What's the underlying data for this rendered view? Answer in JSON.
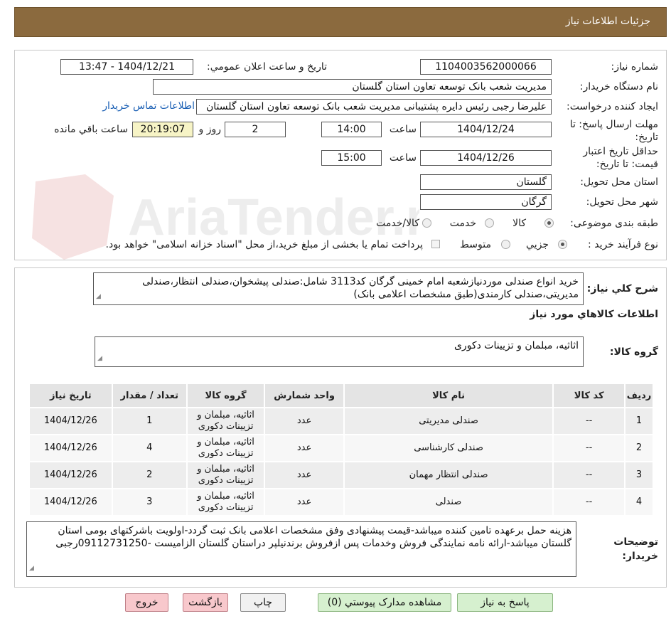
{
  "header": {
    "title": "جزئيات اطلاعات نياز"
  },
  "form": {
    "need_number_label": "شماره نياز:",
    "need_number": "1104003562000066",
    "announce_label": "تاريخ و ساعت اعلان عمومي:",
    "announce_value": "1404/12/21 - 13:47",
    "buyer_org_label": "نام دستگاه خريدار:",
    "buyer_org": "مدیریت شعب بانک توسعه تعاون استان گلستان",
    "creator_label": "ايجاد کننده درخواست:",
    "creator": "علیرضا رجبی رئیس دایره پشتیبانی مدیریت شعب بانک توسعه تعاون استان گلستان",
    "contact_link": "اطلاعات تماس خريدار",
    "deadline_label": "مهلت ارسال پاسخ: تا تاريخ:",
    "deadline_date": "1404/12/24",
    "time_label": "ساعت",
    "deadline_time": "14:00",
    "days": "2",
    "days_label": "روز و",
    "remaining": "20:19:07",
    "remaining_label": "ساعت باقي مانده",
    "validity_label": "حداقل تاريخ اعتبار قيمت: تا تاريخ:",
    "validity_date": "1404/12/26",
    "validity_time": "15:00",
    "province_label": "استان محل تحويل:",
    "province": "گلستان",
    "city_label": "شهر محل تحويل:",
    "city": "گرگان",
    "category_label": "طبقه بندی موضوعی:",
    "category_options": [
      "کالا",
      "خدمت",
      "کالا/خدمت"
    ],
    "purchase_type_label": "نوع فرآيند خريد :",
    "purchase_options": [
      "جزيي",
      "متوسط"
    ],
    "payment_note": "پرداخت تمام یا بخشی از مبلغ خرید،از محل \"اسناد خزانه اسلامی\" خواهد بود."
  },
  "summary": {
    "label": "شرح كلي نياز:",
    "text": "خرید  انواع صندلی  موردنیازشعبه امام خمینی گرگان کد3113 شامل:صندلی پیشخوان،صندلی انتظار،صندلی مدیریتی،صندلی کارمندی(طبق مشخصات اعلامی بانک)",
    "goods_heading": "اطلاعات كالاهاي مورد نياز",
    "group_label": "گروه کالا:",
    "group_value": "اثاثیه، مبلمان و تزیینات دکوری"
  },
  "table": {
    "headers": [
      "رديف",
      "کد کالا",
      "نام کالا",
      "واحد شمارش",
      "گروه کالا",
      "تعداد / مقدار",
      "تاريخ نياز"
    ],
    "rows": [
      [
        "1",
        "--",
        "صندلی مدیریتی",
        "عدد",
        "اثاثیه، مبلمان و تزیینات دکوری",
        "1",
        "1404/12/26"
      ],
      [
        "2",
        "--",
        "صندلی کارشناسی",
        "عدد",
        "اثاثیه، مبلمان و تزیینات دکوری",
        "4",
        "1404/12/26"
      ],
      [
        "3",
        "--",
        "صندلی انتظار مهمان",
        "عدد",
        "اثاثیه، مبلمان و تزیینات دکوری",
        "2",
        "1404/12/26"
      ],
      [
        "4",
        "--",
        "صندلی",
        "عدد",
        "اثاثیه، مبلمان و تزیینات دکوری",
        "3",
        "1404/12/26"
      ]
    ]
  },
  "notes": {
    "label": "توضيحات خريدار:",
    "text": "هزینه حمل برعهده تامین کننده میباشد-قیمت پیشنهادی وفق مشخصات اعلامی بانک ثبت گردد-اولویت باشرکتهای بومی استان گلستان میباشد-ارائه نامه نمایندگی فروش وخدمات پس ازفروش برندنیلپر  دراستان گلستان الزامیست -09112731250رجبی"
  },
  "buttons": {
    "reply": "پاسخ به نياز",
    "docs": "مشاهده مدارک پيوستي (0)",
    "print": "چاپ",
    "back": "بازگشت",
    "exit": "خروج"
  },
  "watermark": {
    "text": "AriaTender.neT"
  },
  "colors": {
    "header": "#8b6a3e",
    "link": "#1a5fb4",
    "remaining_bg": "#f7f4c6",
    "reply_bg": "#d6f0cf",
    "exit_bg": "#f8c8cc"
  }
}
